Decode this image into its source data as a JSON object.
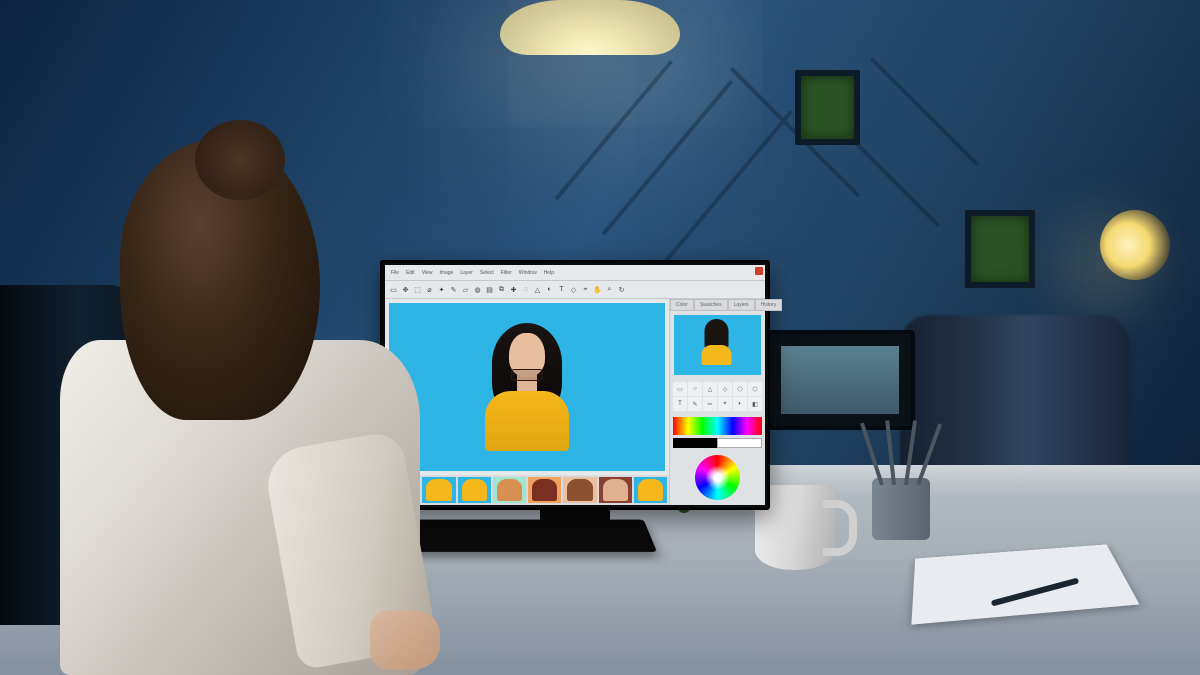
{
  "scene_description": "Woman working late at night at a desk in a blue-lit open office, editing a photo on a desktop monitor running an image-editing application",
  "editor_app": {
    "menu": [
      "File",
      "Edit",
      "View",
      "Image",
      "Layer",
      "Select",
      "Filter",
      "Window",
      "Help"
    ],
    "toolbar_icons": [
      "select",
      "move",
      "crop",
      "lasso",
      "wand",
      "brush",
      "eraser",
      "fill",
      "gradient",
      "clone",
      "heal",
      "blur",
      "sharpen",
      "dodge",
      "text",
      "shape",
      "eyedrop",
      "hand",
      "zoom",
      "rotate"
    ],
    "right_tabs": [
      "Color",
      "Swatches",
      "Layers",
      "History"
    ],
    "sidepanel": {
      "tool_grid": [
        "▭",
        "○",
        "△",
        "◇",
        "⬠",
        "⬡",
        "T",
        "✎",
        "✂",
        "⌖",
        "◐",
        "◧"
      ],
      "color_black": "#000000",
      "color_white": "#ffffff"
    },
    "canvas_image": {
      "subject": "Woman with long dark hair in yellow top holding sunglasses",
      "background_color": "#2db5e5",
      "shirt_color": "#f5b81a"
    },
    "thumbnails": [
      {
        "bg": "#2db5e5",
        "accent": "#f5b81a"
      },
      {
        "bg": "#2db5e5",
        "accent": "#f5b81a"
      },
      {
        "bg": "#2db5e5",
        "accent": "#f5b81a"
      },
      {
        "bg": "#a0e5d0",
        "accent": "#d89050"
      },
      {
        "bg": "#f0a060",
        "accent": "#7a3020"
      },
      {
        "bg": "#e8c0a0",
        "accent": "#8a5030"
      },
      {
        "bg": "#8a4030",
        "accent": "#e0b090"
      },
      {
        "bg": "#2db5e5",
        "accent": "#f5b81a"
      }
    ]
  }
}
